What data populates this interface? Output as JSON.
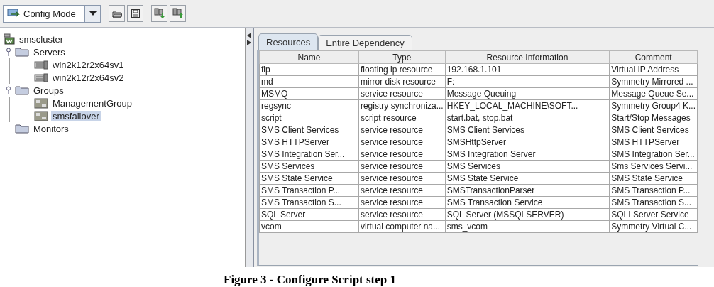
{
  "toolbar": {
    "mode_dropdown": {
      "value": "Config Mode"
    }
  },
  "tree": [
    {
      "label": "smscluster",
      "kind": "cluster",
      "selected": false,
      "children": [
        {
          "label": "Servers",
          "kind": "folder",
          "selected": false,
          "children": [
            {
              "label": "win2k12r2x64sv1",
              "kind": "server",
              "selected": false
            },
            {
              "label": "win2k12r2x64sv2",
              "kind": "server",
              "selected": false
            }
          ]
        },
        {
          "label": "Groups",
          "kind": "folder",
          "selected": false,
          "children": [
            {
              "label": "ManagementGroup",
              "kind": "group",
              "selected": false
            },
            {
              "label": "smsfailover",
              "kind": "group",
              "selected": true
            }
          ]
        },
        {
          "label": "Monitors",
          "kind": "folder",
          "selected": false
        }
      ]
    }
  ],
  "tabs": [
    {
      "label": "Resources",
      "selected": true
    },
    {
      "label": "Entire Dependency",
      "selected": false
    }
  ],
  "table": {
    "columns": [
      "Name",
      "Type",
      "Resource Information",
      "Comment"
    ],
    "rows": [
      [
        "fip",
        "floating ip resource",
        "192.168.1.101",
        "Virtual IP Address"
      ],
      [
        "md",
        "mirror disk resource",
        "F:",
        "Symmetry Mirrored ..."
      ],
      [
        "MSMQ",
        "service resource",
        "Message Queuing",
        "Message Queue Se..."
      ],
      [
        "regsync",
        "registry synchroniza...",
        "HKEY_LOCAL_MACHINE\\SOFT...",
        "Symmetry Group4 K..."
      ],
      [
        "script",
        "script resource",
        "start.bat, stop.bat",
        "Start/Stop Messages"
      ],
      [
        "SMS Client Services",
        "service resource",
        "SMS Client Services",
        "SMS Client Services"
      ],
      [
        "SMS HTTPServer",
        "service resource",
        "SMSHttpServer",
        "SMS HTTPServer"
      ],
      [
        "SMS Integration Ser...",
        "service resource",
        "SMS Integration Server",
        "SMS Integration Ser..."
      ],
      [
        "SMS Services",
        "service resource",
        "SMS Services",
        "Sms Services Servi..."
      ],
      [
        "SMS State Service",
        "service resource",
        "SMS State Service",
        "SMS State Service"
      ],
      [
        "SMS Transaction P...",
        "service resource",
        "SMSTransactionParser",
        "SMS Transaction P..."
      ],
      [
        "SMS Transaction S...",
        "service resource",
        "SMS Transaction Service",
        "SMS Transaction S..."
      ],
      [
        "SQL Server",
        "service resource",
        "SQL Server (MSSQLSERVER)",
        "SQLI Server Service"
      ],
      [
        "vcom",
        "virtual computer na...",
        "sms_vcom",
        "Symmetry Virtual C..."
      ]
    ]
  },
  "caption": "Figure 3 - Configure Script step 1"
}
